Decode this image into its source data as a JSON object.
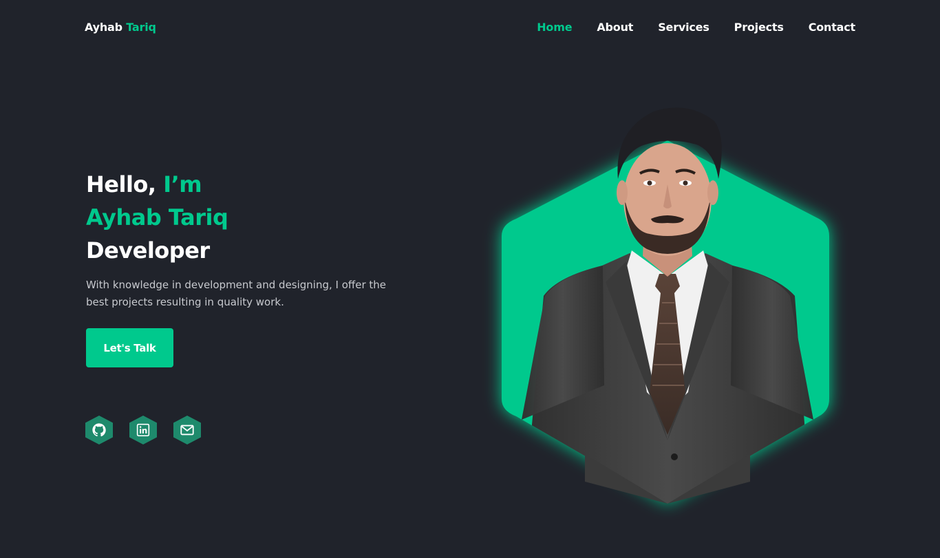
{
  "header": {
    "logo_first": "Ayhab",
    "logo_second": "Tariq",
    "nav": [
      {
        "label": "Home",
        "active": true
      },
      {
        "label": "About",
        "active": false
      },
      {
        "label": "Services",
        "active": false
      },
      {
        "label": "Projects",
        "active": false
      },
      {
        "label": "Contact",
        "active": false
      }
    ]
  },
  "hero": {
    "greeting": "Hello,",
    "greeting_accent": "I’m",
    "name": "Ayhab Tariq",
    "role": "Developer",
    "description": "With knowledge in development and designing, I offer the best projects resulting in quality work.",
    "cta_label": "Let's Talk"
  },
  "social": [
    {
      "icon": "github-icon"
    },
    {
      "icon": "linkedin-icon"
    },
    {
      "icon": "mail-icon"
    }
  ],
  "colors": {
    "background": "#20232b",
    "accent": "#00c98d",
    "social_bg": "#1e8a6c",
    "text_muted": "#c7c9ce"
  }
}
